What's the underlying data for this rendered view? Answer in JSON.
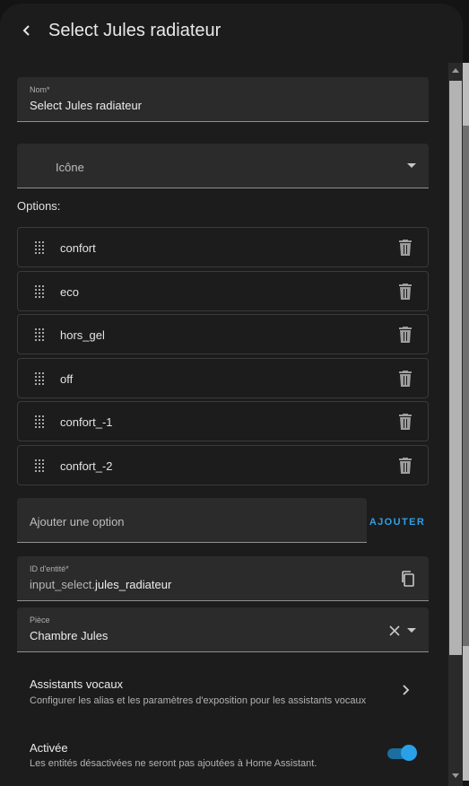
{
  "dialog": {
    "title": "Select Jules radiateur"
  },
  "name_field": {
    "label": "Nom*",
    "value": "Select Jules radiateur"
  },
  "icon_field": {
    "placeholder": "Icône"
  },
  "options": {
    "label": "Options:",
    "items": [
      "confort",
      "eco",
      "hors_gel",
      "off",
      "confort_-1",
      "confort_-2"
    ]
  },
  "add_option": {
    "placeholder": "Ajouter une option",
    "button_label": "AJOUTER"
  },
  "entity_id": {
    "label": "ID d'entité*",
    "prefix": "input_select.",
    "value": "jules_radiateur"
  },
  "area": {
    "label": "Pièce",
    "value": "Chambre Jules"
  },
  "voice_assistants": {
    "title": "Assistants vocaux",
    "subtitle": "Configurer les alias et les paramètres d'exposition pour les assistants vocaux"
  },
  "enabled": {
    "title": "Activée",
    "subtitle": "Les entités désactivées ne seront pas ajoutées à Home Assistant.",
    "state": true
  },
  "colors": {
    "accent": "#2aa0e8",
    "background": "#1c1c1c",
    "field": "#2b2b2b"
  }
}
